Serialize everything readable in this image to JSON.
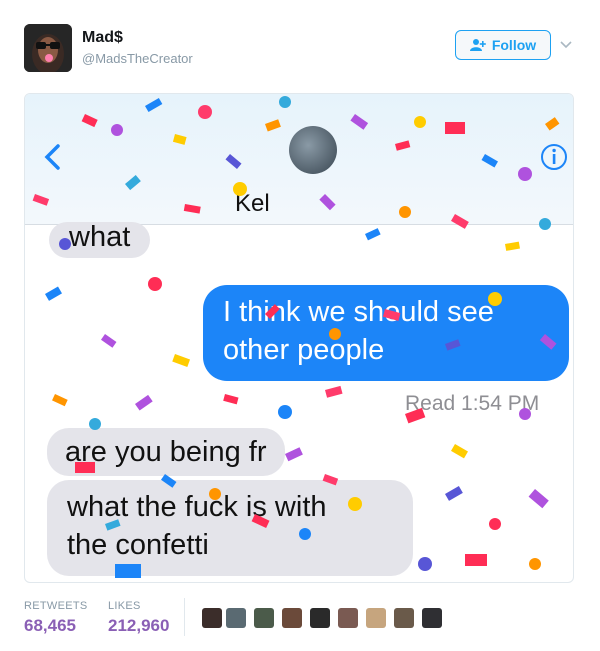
{
  "tweet": {
    "author_name": "Mad$",
    "author_handle": "@MadsTheCreator",
    "follow_label": "Follow"
  },
  "screenshot": {
    "contact_name": "Kel",
    "messages": [
      {
        "dir": "in",
        "lines": [
          "what"
        ]
      },
      {
        "dir": "out",
        "lines": [
          "I think we should see",
          "other people"
        ]
      },
      {
        "dir": "in",
        "lines": [
          "are you being fr"
        ]
      },
      {
        "dir": "in",
        "lines": [
          "what the fuck is with",
          "the confetti"
        ]
      }
    ],
    "read_receipt": "Read 1:54 PM"
  },
  "stats": {
    "retweets_label": "RETWEETS",
    "retweets_value": "68,465",
    "likes_label": "LIKES",
    "likes_value": "212,960"
  },
  "colors": {
    "accent": "#1da1f2",
    "stat_purple": "#8a5fb5",
    "imessage_blue": "#1c85f8",
    "confetti": [
      "#ff2d55",
      "#1c85f8",
      "#ffcc00",
      "#af52de",
      "#ff9500",
      "#34aadc",
      "#ff3b6b",
      "#5856d6"
    ]
  },
  "icons": [
    "follow-person-icon",
    "chevron-down-icon",
    "back-arrow-icon",
    "info-icon"
  ]
}
